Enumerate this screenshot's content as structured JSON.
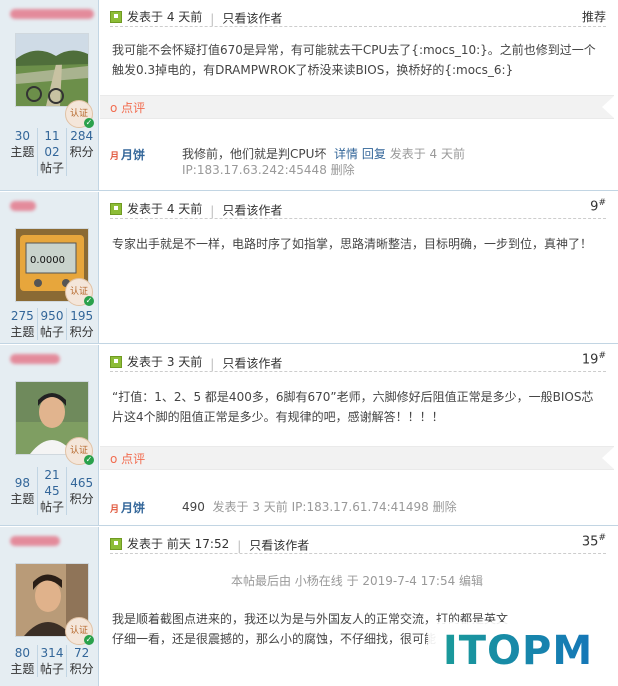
{
  "posts": [
    {
      "posted": "发表于 4 天前",
      "author_only": "只看该作者",
      "floor_label": "推荐",
      "content": "我可能不会怀疑打值670是异常，有可能就去干CPU去了{:mocs_10:}。之前也修到过一个触发0.3掉电的，有DRAMPWROK了桥没来读BIOS，换桥好的{:mocs_6:}",
      "rate_label": "点评",
      "badge": "认证",
      "stats": [
        {
          "num": "30",
          "label": "主题"
        },
        {
          "num": "1102",
          "label": "帖子"
        },
        {
          "num": "284",
          "label": "积分"
        }
      ],
      "comment": {
        "user": "月饼",
        "text": "我修前，他们就是判CPU坏",
        "detail": "详情",
        "reply": "回复",
        "meta": "发表于 4 天前 IP:183.17.63.242:45448",
        "delete": "删除"
      }
    },
    {
      "posted": "发表于 4 天前",
      "author_only": "只看该作者",
      "floor_num": "9",
      "floor_suffix": "#",
      "content": "专家出手就是不一样，电路时序了如指掌，思路清晰整洁，目标明确，一步到位，真神了！",
      "badge": "认证",
      "meter_text": "0.0000",
      "stats": [
        {
          "num": "275",
          "label": "主题"
        },
        {
          "num": "950",
          "label": "帖子"
        },
        {
          "num": "195",
          "label": "积分"
        }
      ]
    },
    {
      "posted": "发表于 3 天前",
      "author_only": "只看该作者",
      "floor_num": "19",
      "floor_suffix": "#",
      "content": "“打值：1、2、5 都是400多，6脚有670”老师，六脚修好后阻值正常是多少，一般BIOS芯片这4个脚的阻值正常是多少。有规律的吧，感谢解答！！！！",
      "rate_label": "点评",
      "badge": "认证",
      "stats": [
        {
          "num": "98",
          "label": "主题"
        },
        {
          "num": "2145",
          "label": "帖子"
        },
        {
          "num": "465",
          "label": "积分"
        }
      ],
      "comment": {
        "user": "月饼",
        "text": "490",
        "meta": "发表于 3 天前 IP:183.17.61.74:41498",
        "delete": "删除"
      }
    },
    {
      "posted": "发表于 前天 17:52",
      "author_only": "只看该作者",
      "floor_num": "35",
      "floor_suffix": "#",
      "edit_note": "本帖最后由 小杨在线 于 2019-7-4 17:54 编辑",
      "content_line1": "我是顺着截图点进来的，我还以为是与外国友人的正常交流，打的都是英文",
      "content_line2": "仔细一看，还是很震撼的，那么小的腐蚀，不仔细找，很可能",
      "badge": "认证",
      "stats": [
        {
          "num": "80",
          "label": "主题"
        },
        {
          "num": "314",
          "label": "帖子"
        },
        {
          "num": "72",
          "label": "积分"
        }
      ]
    }
  ],
  "watermark": "ITOPM",
  "colors": {
    "sidebar_bg": "#e5edf2",
    "link": "#336699",
    "rate": "#f26c4f",
    "watermark_a": "#1a9a9a",
    "watermark_b": "#1577b8"
  }
}
